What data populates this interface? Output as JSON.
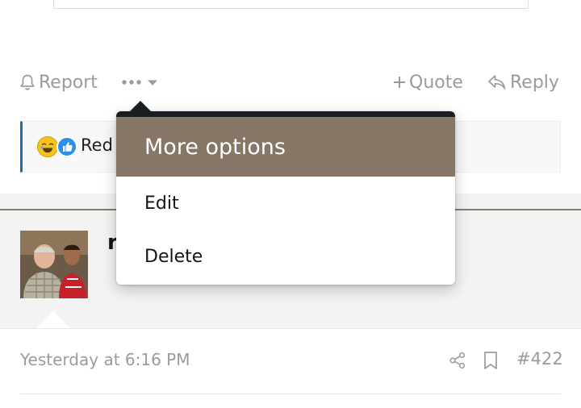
{
  "actions": {
    "report_label": "Report",
    "quote_label": "Quote",
    "reply_label": "Reply"
  },
  "reactions": {
    "text": "Red"
  },
  "menu": {
    "title": "More options",
    "items": [
      "Edit",
      "Delete"
    ]
  },
  "post": {
    "username_initial": "r",
    "timestamp": "Yesterday at 6:16 PM",
    "number": "#422"
  },
  "colors": {
    "menu_header_bg": "#857665",
    "accent_border": "#1b6fa8",
    "muted_text": "#9b9b9b"
  }
}
